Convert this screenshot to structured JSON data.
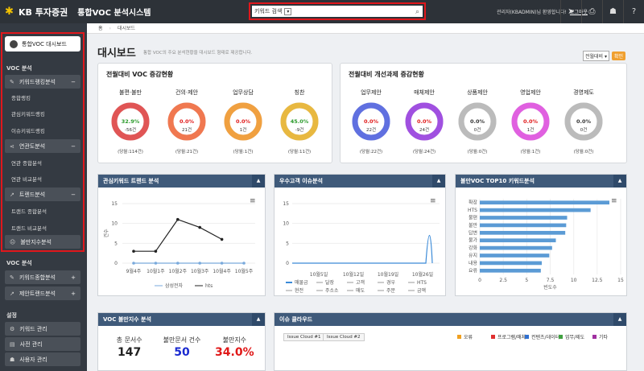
{
  "header": {
    "brand": "KB 투자증권",
    "system_name": "통합VOC 분석시스템",
    "search_select": "키워드 검색",
    "user_text": "관리자(KBADMIN)님 환영합니다!",
    "logout": "로그아웃"
  },
  "breadcrumb": {
    "home": "홈",
    "current": "대시보드"
  },
  "sidebar": {
    "home": "통합VOC 대시보드",
    "section1": "VOC 분석",
    "g1": "키워드랭킹분석",
    "g1_items": [
      "종합랭킹",
      "관심키워드랭킹",
      "이슈키워드랭킹"
    ],
    "g2": "연관도분석",
    "g2_items": [
      "연관 종합분석",
      "연관 비교분석"
    ],
    "g3": "트렌드분석",
    "g3_items": [
      "트랜드 종합분석",
      "트랜드 비교분석"
    ],
    "g4": "불만지수분석",
    "section2": "VOC 분석",
    "g5": "키워드종합분석",
    "g6": "제안트랜드분석",
    "section3": "설정",
    "s1": "키워드 관리",
    "s2": "사전 관리",
    "s3": "사용자 관리"
  },
  "page": {
    "title": "대시보드",
    "desc": "통합 VOC의 주요 분석현황을 대시보드 형태로 제공합니다.",
    "compare_select": "전월대비",
    "confirm": "확인"
  },
  "voc_card": {
    "title": "전월대비 VOC 증감현황",
    "gauges": [
      {
        "label": "불편·불만",
        "pct": "32.9%",
        "cnt": "-56건",
        "total": "(당월:114건)",
        "dir": "down",
        "color": "#e05555"
      },
      {
        "label": "건의·제안",
        "pct": "0.0%",
        "cnt": "21건",
        "total": "(당월:21건)",
        "dir": "up",
        "color": "#f07850"
      },
      {
        "label": "업무상담",
        "pct": "0.0%",
        "cnt": "1건",
        "total": "(당월:1건)",
        "dir": "up",
        "color": "#f0a040"
      },
      {
        "label": "칭찬",
        "pct": "45.0%",
        "cnt": "-9건",
        "total": "(당월:11건)",
        "dir": "down",
        "color": "#e8b840"
      }
    ]
  },
  "sugg_card": {
    "title": "전월대비 개선과제 증감현황",
    "gauges": [
      {
        "label": "업무제안",
        "pct": "0.0%",
        "cnt": "22건",
        "total": "(당월:22건)",
        "dir": "up",
        "color": "#6070e0"
      },
      {
        "label": "매체제안",
        "pct": "0.0%",
        "cnt": "24건",
        "total": "(당월:24건)",
        "dir": "up",
        "color": "#a050e0"
      },
      {
        "label": "상품제안",
        "pct": "0.0%",
        "cnt": "0건",
        "total": "(당월:0건)",
        "dir": "none",
        "color": "#bbbbbb"
      },
      {
        "label": "영업제안",
        "pct": "0.0%",
        "cnt": "1건",
        "total": "(당월:1건)",
        "dir": "up",
        "color": "#e060e0"
      },
      {
        "label": "경영제도",
        "pct": "0.0%",
        "cnt": "0건",
        "total": "(당월:0건)",
        "dir": "none",
        "color": "#bbbbbb"
      }
    ]
  },
  "panels": {
    "p1": "관심키워드 트랜드 분석",
    "p2": "우수고객 이슈분석",
    "p3": "불만VOC TOP10 키워드분석",
    "p4": "VOC 불만지수 분석",
    "p5": "이슈 클라우드"
  },
  "chart_data": [
    {
      "type": "line",
      "x": [
        "9월4주",
        "10월1주",
        "10월2주",
        "10월3주",
        "10월4주",
        "10월5주"
      ],
      "series": [
        {
          "name": "삼성전자",
          "values": [
            0,
            0,
            0,
            0,
            0,
            0
          ]
        },
        {
          "name": "hts",
          "values": [
            3,
            3,
            11,
            9,
            6
          ]
        }
      ],
      "ylabel": "건수",
      "ylim": [
        0,
        15
      ],
      "yticks": [
        0,
        5,
        10,
        15
      ]
    },
    {
      "type": "line",
      "x": [
        "10월5일",
        "10월12일",
        "10월19일",
        "10월26일"
      ],
      "ylim": [
        0,
        15
      ],
      "yticks": [
        0,
        5,
        10,
        15
      ],
      "legend": [
        "매물금",
        "달장",
        "고객",
        "경우",
        "HTS",
        "현전",
        "주소소",
        "매도",
        "주문",
        "금액"
      ]
    },
    {
      "type": "bar",
      "categories": [
        "확장",
        "HTS",
        "불편",
        "불만",
        "답변",
        "불가",
        "강화",
        "유지",
        "내용",
        "요류"
      ],
      "values": [
        13.8,
        11.8,
        9.3,
        9.2,
        9.1,
        8.1,
        7.7,
        7.4,
        6.6,
        6.5
      ],
      "xlim": [
        0,
        15
      ],
      "xticks": [
        0,
        2.5,
        5,
        7.5,
        10,
        12.5,
        15
      ],
      "xlabel": "빈도수"
    }
  ],
  "stats": {
    "k1": "총 문서수",
    "v1": "147",
    "k2": "불만문서 건수",
    "v2": "50",
    "k3": "불만지수",
    "v3": "34.0%"
  },
  "cloud": {
    "tabs": [
      "Issue Cloud #1",
      "Issue Cloud #2"
    ],
    "legend": [
      {
        "label": "오류",
        "color": "#f0a020"
      },
      {
        "label": "프로그램/매체",
        "color": "#e03030"
      },
      {
        "label": "컨텐츠/데이터",
        "color": "#3070d0"
      },
      {
        "label": "업무/제도",
        "color": "#40a040"
      },
      {
        "label": "기타",
        "color": "#a030a0"
      }
    ]
  }
}
